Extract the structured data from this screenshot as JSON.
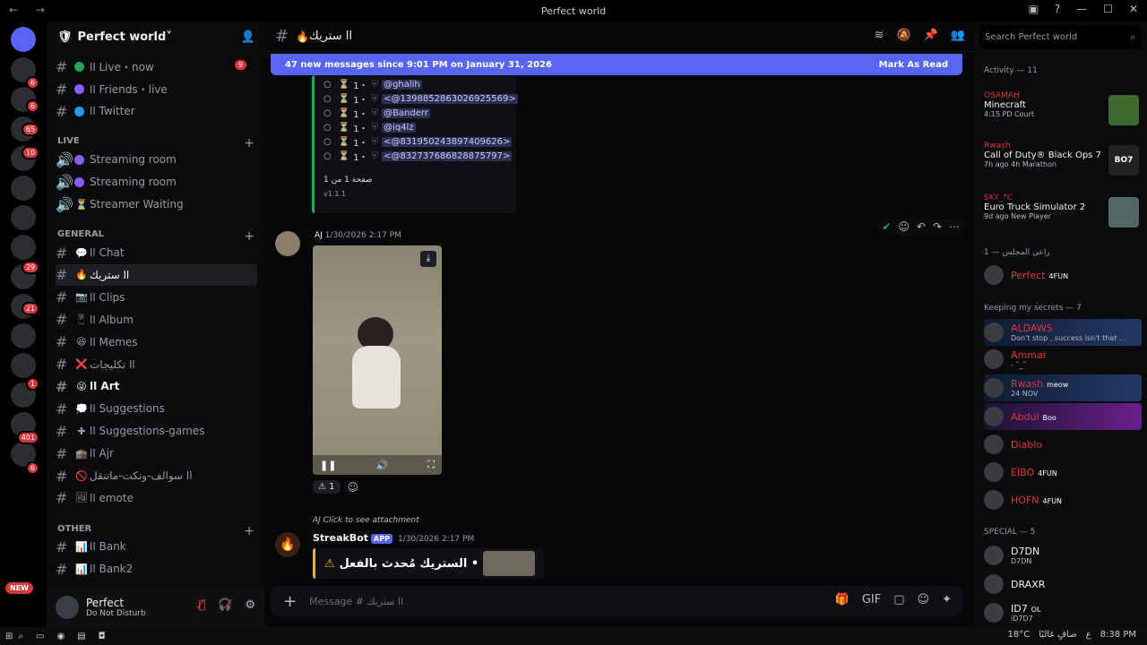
{
  "window": {
    "title": "Perfect world"
  },
  "server": {
    "name": "Perfect world"
  },
  "guild_badges": [
    "6",
    "6",
    "65",
    "10",
    "29",
    "21",
    "1",
    "401",
    "6"
  ],
  "guild_new_label": "NEW",
  "channels_top": [
    {
      "label": "اا Live・now",
      "dot": "#23a559",
      "badge": "9"
    },
    {
      "label": "اا Friends・live",
      "dot": "#8a5cf6"
    },
    {
      "label": "اا Twitter",
      "dot": "#1d9bf0"
    }
  ],
  "cat_live": "LIVE",
  "voice": [
    {
      "label": "Streaming room",
      "dot": "#8a5cf6"
    },
    {
      "label": "Streaming room",
      "dot": "#8a5cf6"
    },
    {
      "label": "Streamer Waiting",
      "emoji": "⏳"
    }
  ],
  "cat_general": "GENERAL",
  "channels_general": [
    {
      "label": "اا Chat",
      "emoji": "💬"
    },
    {
      "label": "اا ستريك",
      "emoji": "🔥",
      "active": true
    },
    {
      "label": "اا Clips",
      "emoji": "📷"
    },
    {
      "label": "اا Album",
      "emoji": "📱"
    },
    {
      "label": "اا Memes",
      "emoji": "😆"
    },
    {
      "label": "اا تكليجات",
      "emoji": "❌"
    },
    {
      "label": "اا Art",
      "emoji": "😜",
      "bold": true
    },
    {
      "label": "اا Suggestions",
      "emoji": "💭"
    },
    {
      "label": "اا Suggestions-games",
      "emoji": "✚"
    },
    {
      "label": "اا Ajr",
      "emoji": "🕋"
    },
    {
      "label": "اا سوالف-ونكت-ماتنقل",
      "emoji": "🚫"
    },
    {
      "label": "اا emote",
      "emoji": "🖼"
    }
  ],
  "cat_other": "Other",
  "channels_other": [
    {
      "label": "اا Bank",
      "emoji": "📊"
    },
    {
      "label": "اا Bank2",
      "emoji": "📊"
    }
  ],
  "user": {
    "name": "Perfect",
    "status": "Do Not Disturb"
  },
  "channel": {
    "name": "اا ستريك",
    "search_placeholder": "Search Perfect world"
  },
  "new_messages": {
    "text": "47 new messages since 9:01 PM on January 31, 2026",
    "action": "Mark As Read"
  },
  "embed": {
    "rows": [
      {
        "num": "1・",
        "mention": "@ghalih"
      },
      {
        "num": "1・",
        "mention": "<@1398852863026925569>"
      },
      {
        "num": "1・",
        "mention": "@Banderr"
      },
      {
        "num": "1・",
        "mention": "@iq4lz"
      },
      {
        "num": "1・",
        "mention": "<@831950243897409626>"
      },
      {
        "num": "1・",
        "mention": "<@832737686828875797>"
      }
    ],
    "page": "صفحة 1 من 1",
    "version": "v1.1.1"
  },
  "message": {
    "author": "AJ",
    "time": "1/30/2026 2:17 PM",
    "reaction_count": "1"
  },
  "reply": {
    "text": "AJ Click to see attachment"
  },
  "bot": {
    "name": "StreakBot",
    "tag": "APP",
    "time": "1/30/2026 2:17 PM",
    "embed_text": "الستريك مُحدث بالفعل •"
  },
  "composer": {
    "placeholder": "Message # اا ستريك"
  },
  "activity": {
    "title": "Activity — 11"
  },
  "activities": [
    {
      "user": "OSAMAH",
      "game": "Minecraft",
      "time": "4:15",
      "note": "PD Court",
      "icon": ""
    },
    {
      "user": "Rwash",
      "game": "Call of Duty® Black Ops 7",
      "time": "7h ago",
      "note": "4h Marathon",
      "icon": "BO7"
    },
    {
      "user": "SKY_°C",
      "game": "Euro Truck Simulator 2",
      "time": "9d ago",
      "note": "New Player",
      "icon": ""
    }
  ],
  "group1": "راعي المجلس — 1",
  "group1_members": [
    {
      "name": "Perfect",
      "tag": "4FUN"
    }
  ],
  "group2": "Keeping my secrets — 7",
  "group2_members": [
    {
      "name": "ALDAWS",
      "status": "Don't stop , success isn't that ...",
      "tag": ""
    },
    {
      "name": "Ammar",
      "status": "- ˆ_ˆ",
      "tag": ""
    },
    {
      "name": "Rwash",
      "status": "24 NOV",
      "tag": "meow"
    },
    {
      "name": "Abdul",
      "status": "",
      "tag": "Boo"
    },
    {
      "name": "Diablo",
      "status": "",
      "tag": ""
    },
    {
      "name": "EIBO",
      "status": "",
      "tag": "4FUN"
    },
    {
      "name": "HOFN",
      "status": "",
      "tag": "4FUN"
    }
  ],
  "group3": "SPECIAL — 5",
  "group3_members": [
    {
      "name": "D7DN",
      "status": "D7DN"
    },
    {
      "name": "DRAXR",
      "status": ""
    },
    {
      "name": "ID7",
      "status": "iD7D7",
      "tag": "OL"
    }
  ],
  "taskbar": {
    "weather": "18°C",
    "weather_text": "صافٍ غالبًا",
    "lang": "ع",
    "time": "8:38 PM"
  }
}
